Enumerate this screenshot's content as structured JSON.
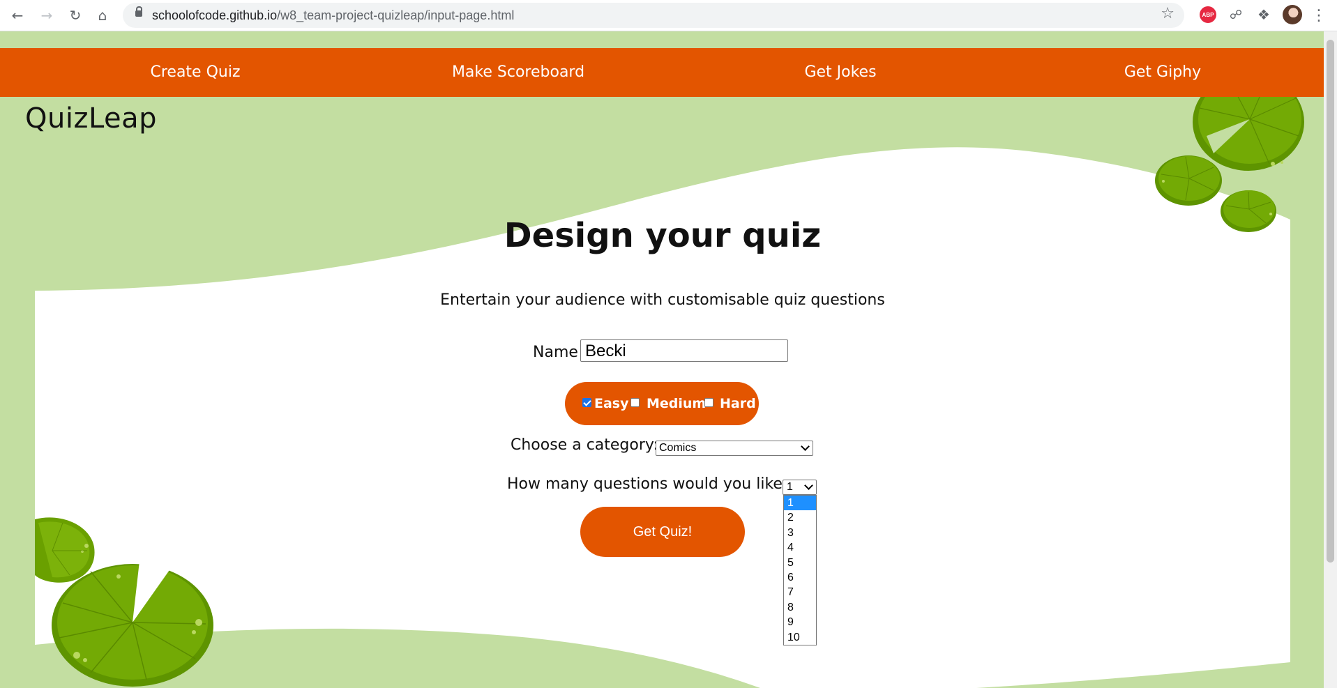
{
  "browser": {
    "url_domain": "schoolofcode.github.io",
    "url_path": "/w8_team-project-quizleap/input-page.html",
    "extension_abp": "ABP"
  },
  "nav": {
    "items": [
      "Create Quiz",
      "Make Scoreboard",
      "Get Jokes",
      "Get Giphy"
    ]
  },
  "logo": "QuizLeap",
  "main": {
    "title": "Design your quiz",
    "subtitle": "Entertain your audience with customisable quiz questions",
    "name_label": "Name",
    "name_value": "Becki",
    "difficulty": [
      {
        "label": "Easy",
        "checked": true
      },
      {
        "label": "Medium",
        "checked": false
      },
      {
        "label": "Hard",
        "checked": false
      }
    ],
    "category_label": "Choose a category:",
    "category_value": "Comics",
    "questions_label": "How many questions would you like:",
    "questions_value": "1",
    "questions_options": [
      "1",
      "2",
      "3",
      "4",
      "5",
      "6",
      "7",
      "8",
      "9",
      "10"
    ],
    "submit_label": "Get Quiz!"
  },
  "colors": {
    "accent": "#e35500",
    "background_green": "#c3dea1",
    "lilypad": "#6aa000"
  }
}
